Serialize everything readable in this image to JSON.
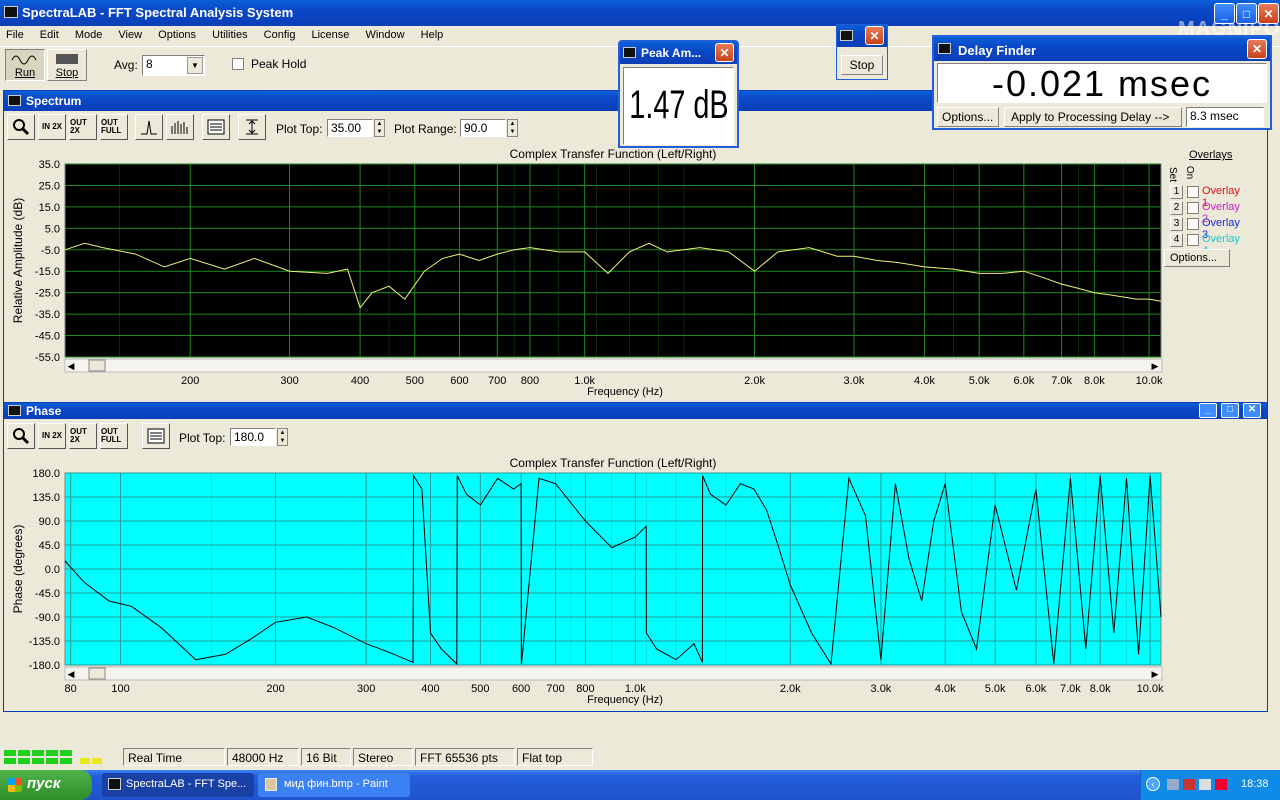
{
  "app": {
    "title": "SpectraLAB - FFT Spectral Analysis System"
  },
  "menu": [
    "File",
    "Edit",
    "Mode",
    "View",
    "Options",
    "Utilities",
    "Config",
    "License",
    "Window",
    "Help"
  ],
  "toolbar": {
    "run_label": "Run",
    "stop_label": "Stop",
    "avg_label": "Avg:",
    "avg_value": "8",
    "peak_hold_label": "Peak Hold"
  },
  "peak_window": {
    "title": "Peak Am...",
    "value": "1.47 dB"
  },
  "stop_window": {
    "stop_label": "Stop"
  },
  "delay_finder": {
    "title": "Delay Finder",
    "value": "-0.021 msec",
    "options_label": "Options...",
    "apply_label": "Apply to Processing Delay -->",
    "delay_value": "8.3 msec"
  },
  "watermark": "MAGNIPOLA",
  "spectrum": {
    "title": "Spectrum",
    "plot_top_label": "Plot Top:",
    "plot_top_value": "35.00",
    "plot_range_label": "Plot Range:",
    "plot_range_value": "90.0",
    "zoom_labels": [
      "IN 2X",
      "OUT 2X",
      "OUT FULL"
    ],
    "overlays_title": "Overlays",
    "set_label": "Set",
    "on_label": "On",
    "overlays": [
      {
        "num": "1",
        "label": "Overlay 1",
        "color": "#e0101a"
      },
      {
        "num": "2",
        "label": "Overlay 2",
        "color": "#d01cd0"
      },
      {
        "num": "3",
        "label": "Overlay 3",
        "color": "#1a2bd8"
      },
      {
        "num": "4",
        "label": "Overlay 4",
        "color": "#18c8d8"
      }
    ],
    "options_label": "Options..."
  },
  "phase": {
    "title": "Phase",
    "plot_top_label": "Plot Top:",
    "plot_top_value": "180.0",
    "zoom_labels": [
      "IN 2X",
      "OUT 2X",
      "OUT FULL"
    ]
  },
  "chart_data": [
    {
      "type": "line",
      "title": "Complex Transfer Function (Left/Right)",
      "xlabel": "Frequency (Hz)",
      "ylabel": "Relative Amplitude (dB)",
      "x_scale": "log",
      "xlim": [
        120,
        10500
      ],
      "ylim": [
        -55,
        35
      ],
      "yticks": [
        "35.0",
        "25.0",
        "15.0",
        "5.0",
        "-5.0",
        "-15.0",
        "-25.0",
        "-35.0",
        "-45.0",
        "-55.0"
      ],
      "xticks": [
        {
          "f": 200,
          "label": "200"
        },
        {
          "f": 300,
          "label": "300"
        },
        {
          "f": 400,
          "label": "400"
        },
        {
          "f": 500,
          "label": "500"
        },
        {
          "f": 600,
          "label": "600"
        },
        {
          "f": 700,
          "label": "700"
        },
        {
          "f": 800,
          "label": "800"
        },
        {
          "f": 1000,
          "label": "1.0k"
        },
        {
          "f": 2000,
          "label": "2.0k"
        },
        {
          "f": 3000,
          "label": "3.0k"
        },
        {
          "f": 4000,
          "label": "4.0k"
        },
        {
          "f": 5000,
          "label": "5.0k"
        },
        {
          "f": 6000,
          "label": "6.0k"
        },
        {
          "f": 7000,
          "label": "7.0k"
        },
        {
          "f": 8000,
          "label": "8.0k"
        },
        {
          "f": 10000,
          "label": "10.0k"
        }
      ],
      "grid": true,
      "background": "#000000",
      "grid_color": "#1f8a1f",
      "series": [
        {
          "color": "#f0f07a",
          "x": [
            120,
            130,
            140,
            160,
            180,
            200,
            230,
            260,
            300,
            350,
            380,
            400,
            420,
            450,
            480,
            520,
            560,
            600,
            650,
            700,
            750,
            800,
            900,
            1000,
            1100,
            1200,
            1300,
            1400,
            1600,
            1800,
            2000,
            2200,
            2500,
            2800,
            3000,
            3300,
            3600,
            4000,
            4500,
            5000,
            5500,
            6000,
            6500,
            7000,
            7500,
            8000,
            8500,
            9000,
            9500,
            10000,
            10500
          ],
          "y": [
            -5,
            -2,
            -4,
            -7,
            -13,
            -9,
            -14,
            -9,
            -15,
            -16,
            -14,
            -32,
            -25,
            -22,
            -28,
            -15,
            -9,
            -7,
            -10,
            -7,
            -5,
            -4,
            -6,
            -6,
            -16,
            -6,
            -2,
            -6,
            -4,
            -6,
            -15,
            -6,
            -4,
            -8,
            -8,
            -10,
            -11,
            -13,
            -14,
            -16,
            -16,
            -15,
            -18,
            -21,
            -23,
            -25,
            -26,
            -27,
            -28,
            -28,
            -29
          ]
        }
      ]
    },
    {
      "type": "line",
      "title": "Complex Transfer Function (Left/Right)",
      "xlabel": "Frequency (Hz)",
      "ylabel": "Phase (degrees)",
      "x_scale": "log",
      "xlim": [
        78,
        10500
      ],
      "ylim": [
        -180,
        180
      ],
      "yticks": [
        "180.0",
        "135.0",
        "90.0",
        "45.0",
        "0.0",
        "-45.0",
        "-90.0",
        "-135.0",
        "-180.0"
      ],
      "xticks": [
        {
          "f": 80,
          "label": "80"
        },
        {
          "f": 100,
          "label": "100"
        },
        {
          "f": 200,
          "label": "200"
        },
        {
          "f": 300,
          "label": "300"
        },
        {
          "f": 400,
          "label": "400"
        },
        {
          "f": 500,
          "label": "500"
        },
        {
          "f": 600,
          "label": "600"
        },
        {
          "f": 700,
          "label": "700"
        },
        {
          "f": 800,
          "label": "800"
        },
        {
          "f": 1000,
          "label": "1.0k"
        },
        {
          "f": 2000,
          "label": "2.0k"
        },
        {
          "f": 3000,
          "label": "3.0k"
        },
        {
          "f": 4000,
          "label": "4.0k"
        },
        {
          "f": 5000,
          "label": "5.0k"
        },
        {
          "f": 6000,
          "label": "6.0k"
        },
        {
          "f": 7000,
          "label": "7.0k"
        },
        {
          "f": 8000,
          "label": "8.0k"
        },
        {
          "f": 10000,
          "label": "10.0k"
        }
      ],
      "grid": true,
      "background": "#00ffff",
      "grid_color": "#2a9a9a",
      "series": [
        {
          "color": "#000000",
          "x": [
            78,
            85,
            95,
            105,
            120,
            140,
            160,
            180,
            200,
            230,
            260,
            300,
            330,
            370,
            371,
            385,
            400,
            420,
            450,
            451,
            470,
            500,
            540,
            580,
            600,
            601,
            650,
            700,
            800,
            900,
            1000,
            1050,
            1051,
            1100,
            1200,
            1300,
            1350,
            1351,
            1400,
            1500,
            1600,
            1700,
            1800,
            1900,
            2000,
            2200,
            2400,
            2600,
            2800,
            3000,
            3200,
            3400,
            3600,
            3800,
            4000,
            4300,
            4600,
            5000,
            5500,
            6000,
            6500,
            7000,
            7500,
            8000,
            8500,
            9000,
            9500,
            10000,
            10500
          ],
          "y": [
            15,
            -25,
            -60,
            -70,
            -110,
            -170,
            -160,
            -130,
            -100,
            -90,
            -110,
            -140,
            -155,
            -175,
            175,
            150,
            -120,
            -150,
            -178,
            175,
            140,
            120,
            170,
            150,
            160,
            -178,
            170,
            160,
            90,
            40,
            60,
            80,
            -120,
            -150,
            -170,
            -140,
            -175,
            175,
            140,
            120,
            160,
            150,
            110,
            40,
            -30,
            -120,
            -178,
            170,
            100,
            -170,
            160,
            20,
            -60,
            90,
            160,
            -80,
            -150,
            120,
            -40,
            150,
            -178,
            170,
            -150,
            175,
            -120,
            170,
            -160,
            175,
            -90
          ]
        }
      ]
    }
  ],
  "status": {
    "mode": "Real Time",
    "rate": "48000 Hz",
    "bits": "16 Bit",
    "channels": "Stereo",
    "fft": "FFT 65536 pts",
    "window": "Flat top"
  },
  "taskbar": {
    "start_label": "пуск",
    "task1": "SpectraLAB - FFT Spe...",
    "task2": "мид фин.bmp - Paint",
    "clock": "18:38"
  }
}
